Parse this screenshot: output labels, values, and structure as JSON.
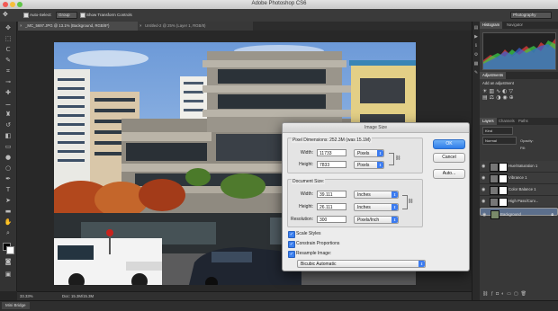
{
  "window": {
    "title": "Adobe Photoshop CS6"
  },
  "options_bar": {
    "auto_select": "Auto-Select:",
    "auto_select_value": "Group",
    "show_transform": "Show Transform Controls",
    "workspace": "Photography"
  },
  "tabs": [
    {
      "label": "_MC_5697.JPG @ 13.1% (Background, RGB/8*)",
      "active": true
    },
    {
      "label": "Untitled-2 @ 25% (Layer 1, RGB/8)",
      "active": false
    }
  ],
  "status": {
    "zoom": "33.33%",
    "doc": "Doc: 15.3M/15.3M"
  },
  "mini_bridge": {
    "label": "Mini Bridge"
  },
  "panels": {
    "top_tabs": [
      "Histogram",
      "Navigator"
    ],
    "adjust_tabs": [
      "Adjustments"
    ],
    "adjust_hint": "Add an adjustment",
    "layer_tabs": [
      "Layers",
      "Channels",
      "Paths"
    ],
    "blend_mode": "Normal",
    "opacity_label": "Opacity:",
    "fill_label": "Fill:",
    "kind_label": "Kind",
    "layers": [
      {
        "name": "Hue/Saturation 1",
        "selected": false
      },
      {
        "name": "Vibrance 1",
        "selected": false
      },
      {
        "name": "Color Balance 1",
        "selected": false
      },
      {
        "name": "High Pass/Curv...",
        "selected": false
      },
      {
        "name": "Background",
        "selected": true
      }
    ]
  },
  "dialog": {
    "title": "Image Size",
    "pixel_dimensions": "Pixel Dimensions: 252.3M (was 15.1M)",
    "px_width_label": "Width:",
    "px_width_value": "11733",
    "px_width_unit": "Pixels",
    "px_height_label": "Height:",
    "px_height_value": "7833",
    "px_height_unit": "Pixels",
    "doc_size": "Document Size:",
    "doc_width_label": "Width:",
    "doc_width_value": "39.111",
    "doc_width_unit": "Inches",
    "doc_height_label": "Height:",
    "doc_height_value": "26.111",
    "doc_height_unit": "Inches",
    "res_label": "Resolution:",
    "res_value": "300",
    "res_unit": "Pixels/Inch",
    "scale_styles": "Scale Styles",
    "constrain": "Constrain Proportions",
    "resample": "Resample Image:",
    "resample_method": "Bicubic Automatic",
    "ok": "OK",
    "cancel": "Cancel",
    "auto": "Auto..."
  }
}
